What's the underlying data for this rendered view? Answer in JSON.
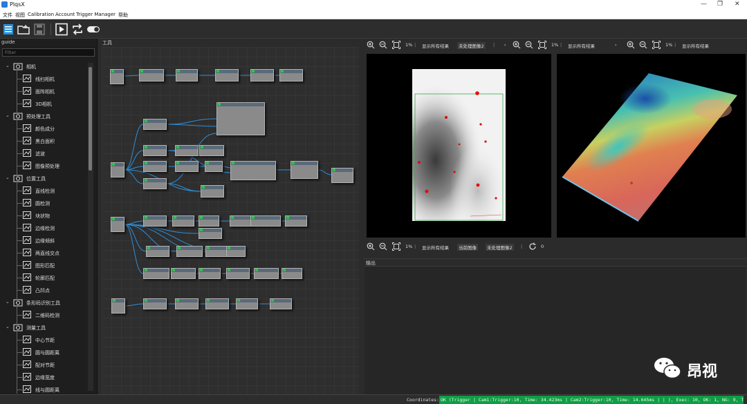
{
  "window": {
    "title": "PlqsX"
  },
  "menu": {
    "items": [
      "文件",
      "视图",
      "Calibration",
      "Account",
      "Trigger Manager",
      "帮助"
    ]
  },
  "toolbar": {
    "buttons": [
      "list-icon",
      "open-folder-icon",
      "save-icon",
      "run-icon",
      "loop-icon",
      "toggle-icon"
    ]
  },
  "left_panel": {
    "header": "guide",
    "filter_placeholder": "Filter",
    "tree": [
      {
        "label": "相机",
        "level": 0,
        "expanded": true
      },
      {
        "label": "线扫相机",
        "level": 1
      },
      {
        "label": "面阵相机",
        "level": 1
      },
      {
        "label": "3D相机",
        "level": 1
      },
      {
        "label": "预处理工具",
        "level": 0,
        "expanded": true
      },
      {
        "label": "颜色成分",
        "level": 1
      },
      {
        "label": "黑白面积",
        "level": 1
      },
      {
        "label": "滤波",
        "level": 1
      },
      {
        "label": "图像预处理",
        "level": 1
      },
      {
        "label": "位置工具",
        "level": 0,
        "expanded": true
      },
      {
        "label": "直线检测",
        "level": 1
      },
      {
        "label": "圆检测",
        "level": 1
      },
      {
        "label": "块状物",
        "level": 1
      },
      {
        "label": "边缘检测",
        "level": 1
      },
      {
        "label": "边缘倾斜",
        "level": 1
      },
      {
        "label": "两直线交点",
        "level": 1
      },
      {
        "label": "图形匹配",
        "level": 1
      },
      {
        "label": "轮廓匹配",
        "level": 1
      },
      {
        "label": "凸凹点",
        "level": 1
      },
      {
        "label": "条形码识别工具",
        "level": 0,
        "expanded": true
      },
      {
        "label": "二维码检测",
        "level": 1
      },
      {
        "label": "测量工具",
        "level": 0,
        "expanded": true
      },
      {
        "label": "中心节距",
        "level": 1
      },
      {
        "label": "圆与圆距离",
        "level": 1
      },
      {
        "label": "配对节距",
        "level": 1
      },
      {
        "label": "边缘宽度",
        "level": 1
      },
      {
        "label": "线与圆距离",
        "level": 1
      }
    ]
  },
  "canvas_panel": {
    "header": "工具"
  },
  "view_toolbars": {
    "top": [
      {
        "zoom": "1%",
        "show_all": "显示所有结果",
        "dropdown": "未处理图像2"
      },
      {
        "zoom": "1%",
        "show_all": "显示所有结果"
      },
      {
        "zoom": "1%",
        "show_all": "显示所有结果"
      }
    ],
    "bottom": {
      "zoom": "1%",
      "show_all": "显示所有结果",
      "dropdown1": "当前图像",
      "dropdown2": "未处理图像2",
      "refresh_count": "0"
    }
  },
  "output_panel": {
    "header": "输出"
  },
  "statusbar": {
    "coordinates_label": "Coordinates:",
    "status_text": "OK (Trigger | Cam1:Trigger:10, Time: 34.423ms | Cam2:Trigger:10, Time: 14.645ms | | ), Exec: 10, OK: 1, NG: 9, Time: 418.931ms)"
  },
  "watermark": {
    "text": "昂视"
  },
  "colors": {
    "status_ok": "#0f9d45",
    "node_header": "#5a6a7a",
    "node_ok": "#2ec34a",
    "wire": "#2f8fd9"
  }
}
